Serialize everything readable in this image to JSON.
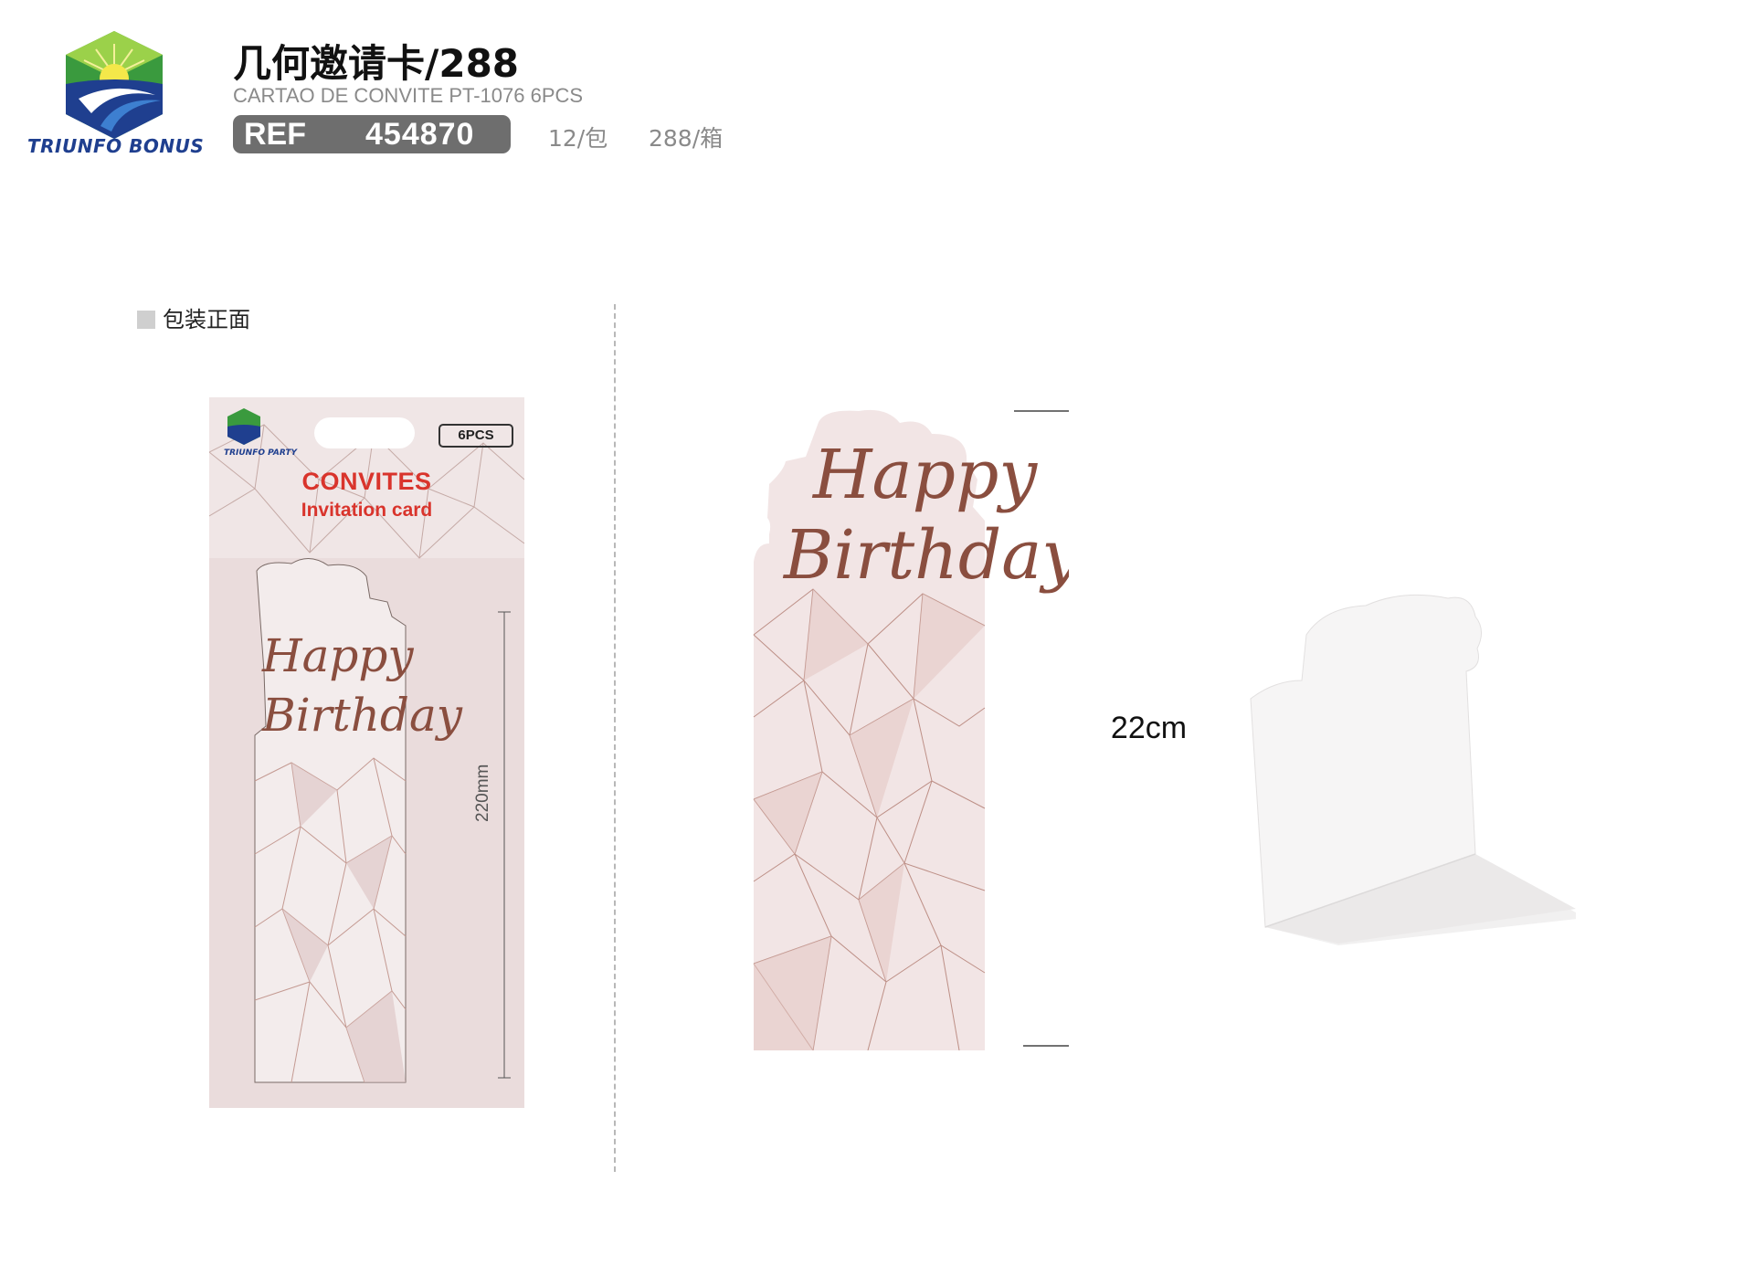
{
  "header": {
    "brand": "TRIUNFO BONUS",
    "title": "几何邀请卡/288",
    "subtitle": "CARTAO DE CONVITE PT-1076 6PCS",
    "ref_label": "REF",
    "ref_number": "454870",
    "pack_qty": "12/包",
    "box_qty": "288/箱"
  },
  "section": {
    "label": "包装正面"
  },
  "package": {
    "brand": "TRIUNFO PARTY",
    "count": "6PCS",
    "title": "CONVITES",
    "subtitle": "Invitation card",
    "card_line1": "Happy",
    "card_line2": "Birthday",
    "dimension": "220mm"
  },
  "card": {
    "line1": "Happy",
    "line2": "Birthday",
    "dimension": "22cm"
  },
  "colors": {
    "accent_red": "#d9342c",
    "rose_gold": "#8a4e3f",
    "card_pink": "#ecdcdc",
    "badge_gray": "#6e6e6e",
    "brand_blue": "#1f3f8f",
    "brand_green": "#3a9a3e"
  }
}
